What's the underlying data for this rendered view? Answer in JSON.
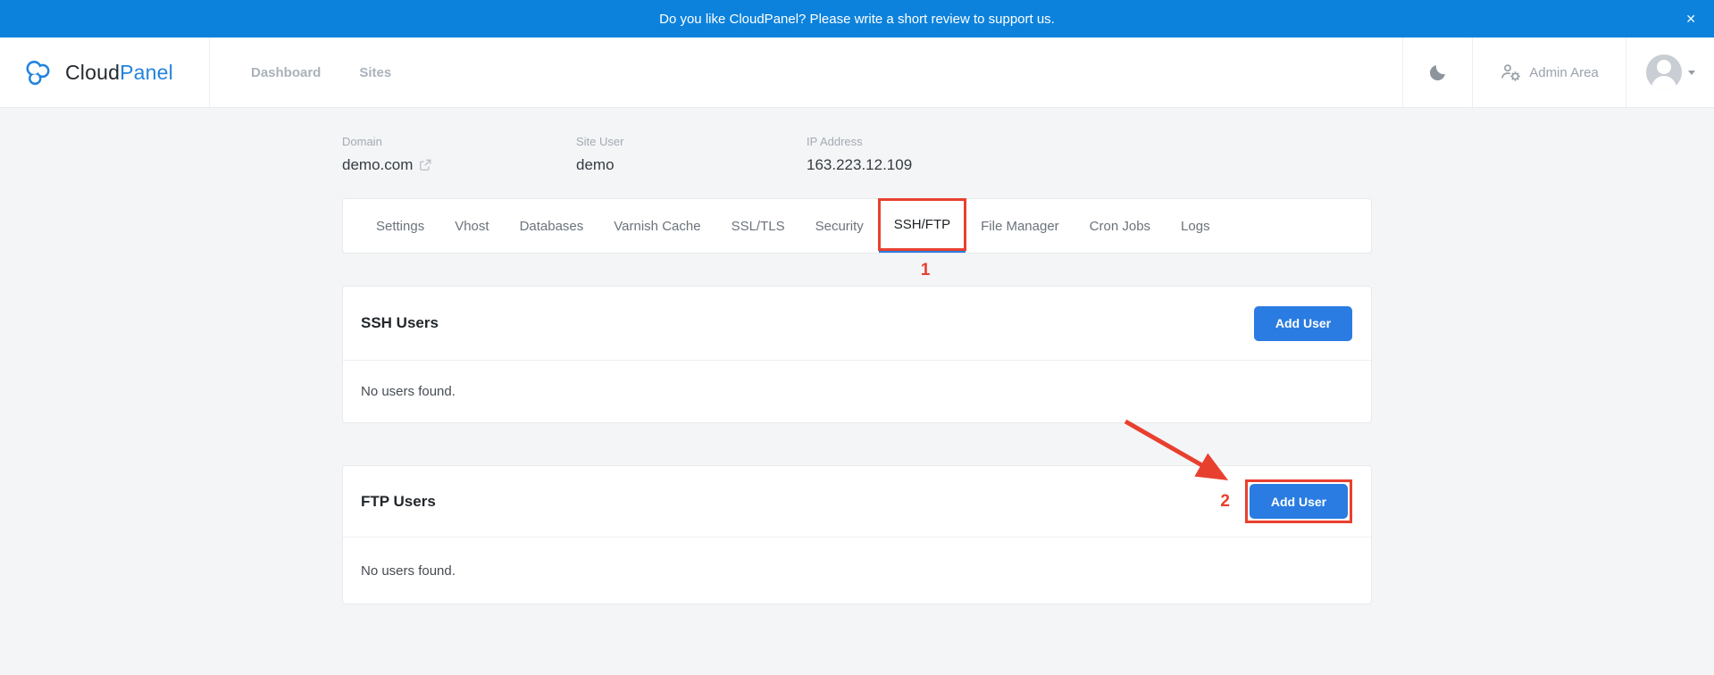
{
  "banner": {
    "message": "Do you like CloudPanel? Please write a short review to support us.",
    "close_glyph": "✕"
  },
  "brand": {
    "word1": "Cloud",
    "word2": "Panel"
  },
  "nav": {
    "items": [
      {
        "label": "Dashboard"
      },
      {
        "label": "Sites"
      }
    ]
  },
  "header_right": {
    "admin_area_label": "Admin Area"
  },
  "site_info": {
    "fields": [
      {
        "label": "Domain",
        "value": "demo.com"
      },
      {
        "label": "Site User",
        "value": "demo"
      },
      {
        "label": "IP Address",
        "value": "163.223.12.109"
      }
    ]
  },
  "tabs": {
    "items": [
      "Settings",
      "Vhost",
      "Databases",
      "Varnish Cache",
      "SSL/TLS",
      "Security",
      "SSH/FTP",
      "File Manager",
      "Cron Jobs",
      "Logs"
    ],
    "active": "SSH/FTP"
  },
  "annotations": {
    "step1": "1",
    "step2": "2",
    "color": "#e8402f"
  },
  "sections": {
    "ssh": {
      "title": "SSH Users",
      "action_label": "Add User",
      "empty_text": "No users found."
    },
    "ftp": {
      "title": "FTP Users",
      "action_label": "Add User",
      "empty_text": "No users found."
    }
  },
  "colors": {
    "banner_blue": "#0c82dc",
    "primary_button_blue": "#2a7ce2",
    "brand_blue": "#2383dd",
    "annotation_red": "#e8402f",
    "page_background": "#f4f5f7"
  }
}
